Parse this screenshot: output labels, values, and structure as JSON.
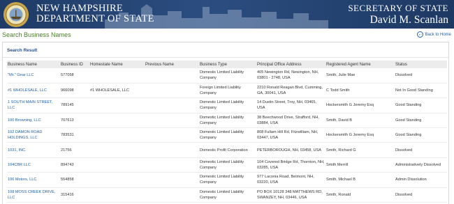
{
  "header": {
    "dept_line1": "NEW HAMPSHIRE",
    "dept_line2": "DEPARTMENT OF STATE",
    "office_title": "SECRETARY OF STATE",
    "official_name": "David M. Scanlan"
  },
  "page": {
    "title": "Search Business Names",
    "back_label": "Back to Home"
  },
  "results": {
    "title": "Search Result",
    "columns": [
      "Business Name",
      "Business ID",
      "Homestate Name",
      "Previous Name",
      "Business Type",
      "Principal Office Address",
      "Registered Agent Name",
      "Status"
    ],
    "rows": [
      [
        "\"Mr.\" Gear LLC",
        "577058",
        "",
        "",
        "Domestic Limited Liability Company",
        "405 Newington Rd, Newington, NH, 03801 - 2748, USA",
        "Smith, Julie Mae",
        "Dissolved"
      ],
      [
        "#1 WHOLESALE, LLC",
        "966098",
        "#1 WHOLESALE, LLC",
        "",
        "Foreign Limited Liability Company",
        "2210 Ronald Reagan Blvd, Cumming, GA, 30041, USA",
        "C Todd Smith",
        "Not In Good Standing"
      ],
      [
        "1 SOUTH MAIN STREET, LLC",
        "789145",
        "",
        "",
        "Domestic Limited Liability Company",
        "14 Dustin Street, Troy, NH, 03465, USA",
        "Hockersmith G Jeremy Esq",
        "Good Standing"
      ],
      [
        "100 Browning, LLC",
        "707613",
        "",
        "",
        "Domestic Limited Liability Company",
        "38 Beechwood Drive, Strafford, NH, 03884, USA",
        "Smith, David B",
        "Good Standing"
      ],
      [
        "102 DAMON ROAD HOLDINGS, LLC",
        "783531",
        "",
        "",
        "Domestic Limited Liability Company",
        "808 Fullam Hill Rd, Fitzwilliam, NH, 03447, USA",
        "Hockersmith G Jeremy Esq",
        "Good Standing"
      ],
      [
        "1031, INC.",
        "21756",
        "",
        "",
        "Domestic Profit Corporation",
        "PETERBOROUGH, NH, 03458, USA",
        "Smith, Richard G",
        "Dissolved"
      ],
      [
        "104CBR LLC",
        "894743",
        "",
        "",
        "Domestic Limited Liability Company",
        "104 Covered Bridge Rd, Thornton, NH, 03285, USA",
        "Smith Merrill",
        "Administratively Dissolved"
      ],
      [
        "106 Motors, LLC",
        "554858",
        "",
        "",
        "Domestic Limited Liability Company",
        "977 Laconia Road, Belmont, NH, 03220, USA",
        "Smith, Michael B",
        "Admin Dissolution"
      ],
      [
        "108 MOSS CREEK DRIVE, LLC",
        "315416",
        "",
        "",
        "Domestic Limited Liability Company",
        "PO BOX 10128 348 MATTHEWS RD, SWANZEY, NH, 03446, USA",
        "Smith, Ronald",
        "Dissolved"
      ]
    ]
  },
  "colors": {
    "banner": "#2b4d80",
    "title_green": "#4b7d2a",
    "link_blue": "#1d5fa5"
  },
  "icons": {
    "seal": "state-seal-icon",
    "back": "back-arrow-icon"
  }
}
